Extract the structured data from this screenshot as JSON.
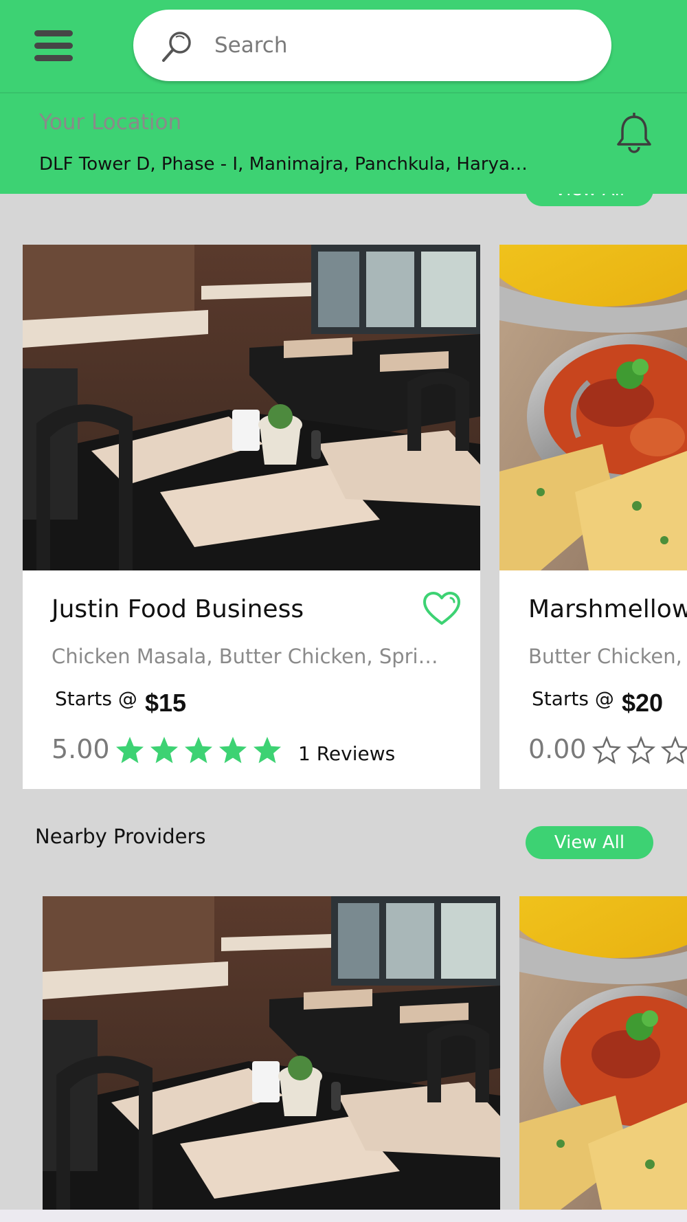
{
  "header": {
    "search_placeholder": "Search",
    "location_label": "Your Location",
    "location_address": "DLF Tower D, Phase - I, Manimajra, Panchkula, Haryan…"
  },
  "top_section": {
    "view_all_label": "View All"
  },
  "featured_cards": [
    {
      "title": "Justin Food Business",
      "subtitle": "Chicken Masala, Butter Chicken, Sprin…",
      "starts_label": "Starts @",
      "price": "$15",
      "rating": "5.00",
      "rating_value": 5,
      "reviews": "1 Reviews",
      "image": "restaurant-interior",
      "favorite": true
    },
    {
      "title": "Marshmellow",
      "subtitle": "Butter Chicken,",
      "starts_label": "Starts @",
      "price": "$20",
      "rating": "0.00",
      "rating_value": 0,
      "reviews": "",
      "image": "indian-food-dishes",
      "favorite": false
    }
  ],
  "nearby": {
    "title": "Nearby Providers",
    "view_all_label": "View All",
    "images": [
      "restaurant-interior",
      "indian-food-dishes"
    ]
  },
  "colors": {
    "accent": "#3dd273",
    "background": "#d6d6d6",
    "icon_dark": "#464646"
  }
}
